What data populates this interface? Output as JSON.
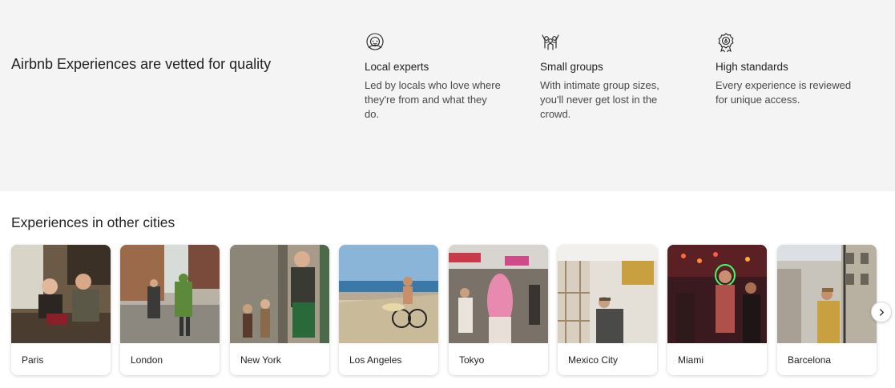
{
  "quality": {
    "title": "Airbnb Experiences are vetted for quality",
    "features": [
      {
        "icon": "local-expert-icon",
        "title": "Local experts",
        "description": "Led by locals who love where they're from and what they do."
      },
      {
        "icon": "small-groups-icon",
        "title": "Small groups",
        "description": "With intimate group sizes, you'll never get lost in the crowd."
      },
      {
        "icon": "high-standards-icon",
        "title": "High standards",
        "description": "Every experience is reviewed for unique access."
      }
    ]
  },
  "cities": {
    "title": "Experiences in other cities",
    "items": [
      {
        "name": "Paris"
      },
      {
        "name": "London"
      },
      {
        "name": "New York"
      },
      {
        "name": "Los Angeles"
      },
      {
        "name": "Tokyo"
      },
      {
        "name": "Mexico City"
      },
      {
        "name": "Miami"
      },
      {
        "name": "Barcelona"
      }
    ],
    "next_icon": "chevron-right-icon"
  }
}
